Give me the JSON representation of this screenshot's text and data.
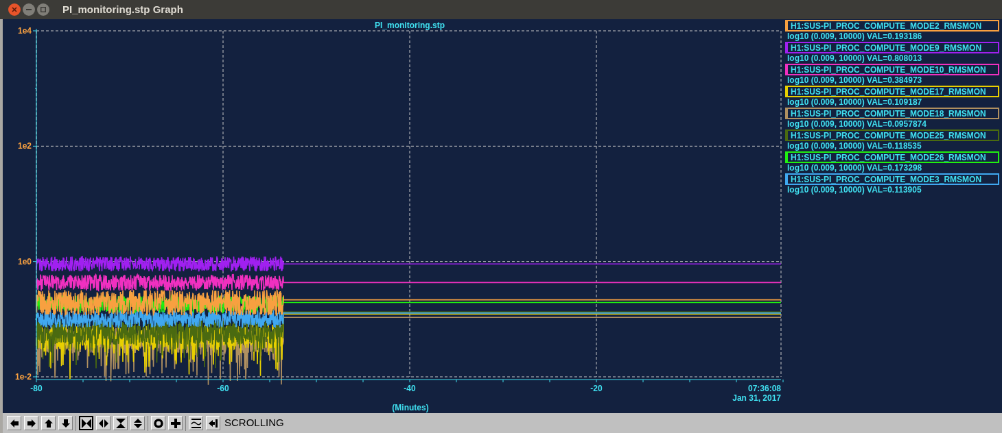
{
  "window": {
    "title": "PI_monitoring.stp Graph"
  },
  "plot": {
    "title": "PI_monitoring.stp",
    "xlabel": "(Minutes)",
    "yticks": [
      {
        "label": "1e4"
      },
      {
        "label": "1e2"
      },
      {
        "label": "1e0"
      },
      {
        "label": "1e-2"
      }
    ],
    "xticks": [
      {
        "label": "-80"
      },
      {
        "label": "-60"
      },
      {
        "label": "-40"
      },
      {
        "label": "-20"
      }
    ],
    "end_time": "07:36:08",
    "end_date": "Jan 31, 2017"
  },
  "legend": [
    {
      "name": "H1:SUS-PI_PROC_COMPUTE_MODE2_RMSMON",
      "scale": "log10 (0.009, 10000) VAL=0.193186",
      "color": "#f8a040"
    },
    {
      "name": "H1:SUS-PI_PROC_COMPUTE_MODE9_RMSMON",
      "scale": "log10 (0.009, 10000) VAL=0.808013",
      "color": "#a020f0"
    },
    {
      "name": "H1:SUS-PI_PROC_COMPUTE_MODE10_RMSMON",
      "scale": "log10 (0.009, 10000) VAL=0.384973",
      "color": "#f030c0"
    },
    {
      "name": "H1:SUS-PI_PROC_COMPUTE_MODE17_RMSMON",
      "scale": "log10 (0.009, 10000) VAL=0.109187",
      "color": "#e8d000"
    },
    {
      "name": "H1:SUS-PI_PROC_COMPUTE_MODE18_RMSMON",
      "scale": "log10 (0.009, 10000) VAL=0.0957874",
      "color": "#b09060"
    },
    {
      "name": "H1:SUS-PI_PROC_COMPUTE_MODE25_RMSMON",
      "scale": "log10 (0.009, 10000) VAL=0.118535",
      "color": "#4a6a10"
    },
    {
      "name": "H1:SUS-PI_PROC_COMPUTE_MODE26_RMSMON",
      "scale": "log10 (0.009, 10000) VAL=0.173298",
      "color": "#20f010"
    },
    {
      "name": "H1:SUS-PI_PROC_COMPUTE_MODE3_RMSMON",
      "scale": "log10 (0.009, 10000) VAL=0.113905",
      "color": "#40a8f0"
    }
  ],
  "toolbar": {
    "buttons": [
      {
        "kind": "left",
        "selected": false
      },
      {
        "kind": "right",
        "selected": false
      },
      {
        "kind": "up",
        "selected": false
      },
      {
        "kind": "down",
        "selected": false
      },
      {
        "kind": "zoom-both",
        "selected": true
      },
      {
        "kind": "zoom-x",
        "selected": false
      },
      {
        "kind": "zoom-y",
        "selected": false
      },
      {
        "kind": "expand-y",
        "selected": false
      },
      {
        "kind": "circle",
        "selected": false
      },
      {
        "kind": "plus",
        "selected": false
      },
      {
        "kind": "wave",
        "selected": false
      },
      {
        "kind": "end",
        "selected": false
      }
    ],
    "mode": "SCROLLING"
  }
}
